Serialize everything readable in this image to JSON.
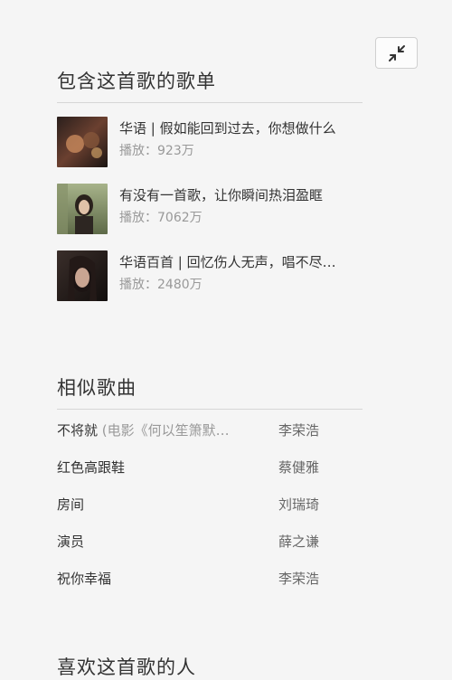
{
  "playlists_section": {
    "title": "包含这首歌的歌单",
    "items": [
      {
        "title": "华语 | 假如能回到过去，你想做什么",
        "plays_label": "播放：",
        "plays": "923万"
      },
      {
        "title": "有没有一首歌，让你瞬间热泪盈眶",
        "plays_label": "播放：",
        "plays": "7062万"
      },
      {
        "title": "华语百首 | 回忆伤人无声，唱不尽…",
        "plays_label": "播放：",
        "plays": "2480万"
      }
    ]
  },
  "similar_section": {
    "title": "相似歌曲",
    "songs": [
      {
        "name": "不将就",
        "extra": " (电影《何以笙箫默…",
        "artist": "李荣浩"
      },
      {
        "name": "红色高跟鞋",
        "extra": "",
        "artist": "蔡健雅"
      },
      {
        "name": "房间",
        "extra": "",
        "artist": "刘瑞琦"
      },
      {
        "name": "演员",
        "extra": "",
        "artist": "薛之谦"
      },
      {
        "name": "祝你幸福",
        "extra": "",
        "artist": "李荣浩"
      }
    ]
  },
  "next_section": {
    "title": "喜欢这首歌的人"
  },
  "icons": {
    "collapse": "collapse-arrows-icon"
  },
  "colors": {
    "background": "#f5f5f5",
    "muted_text": "#999999",
    "divider": "#d6d6d6"
  }
}
